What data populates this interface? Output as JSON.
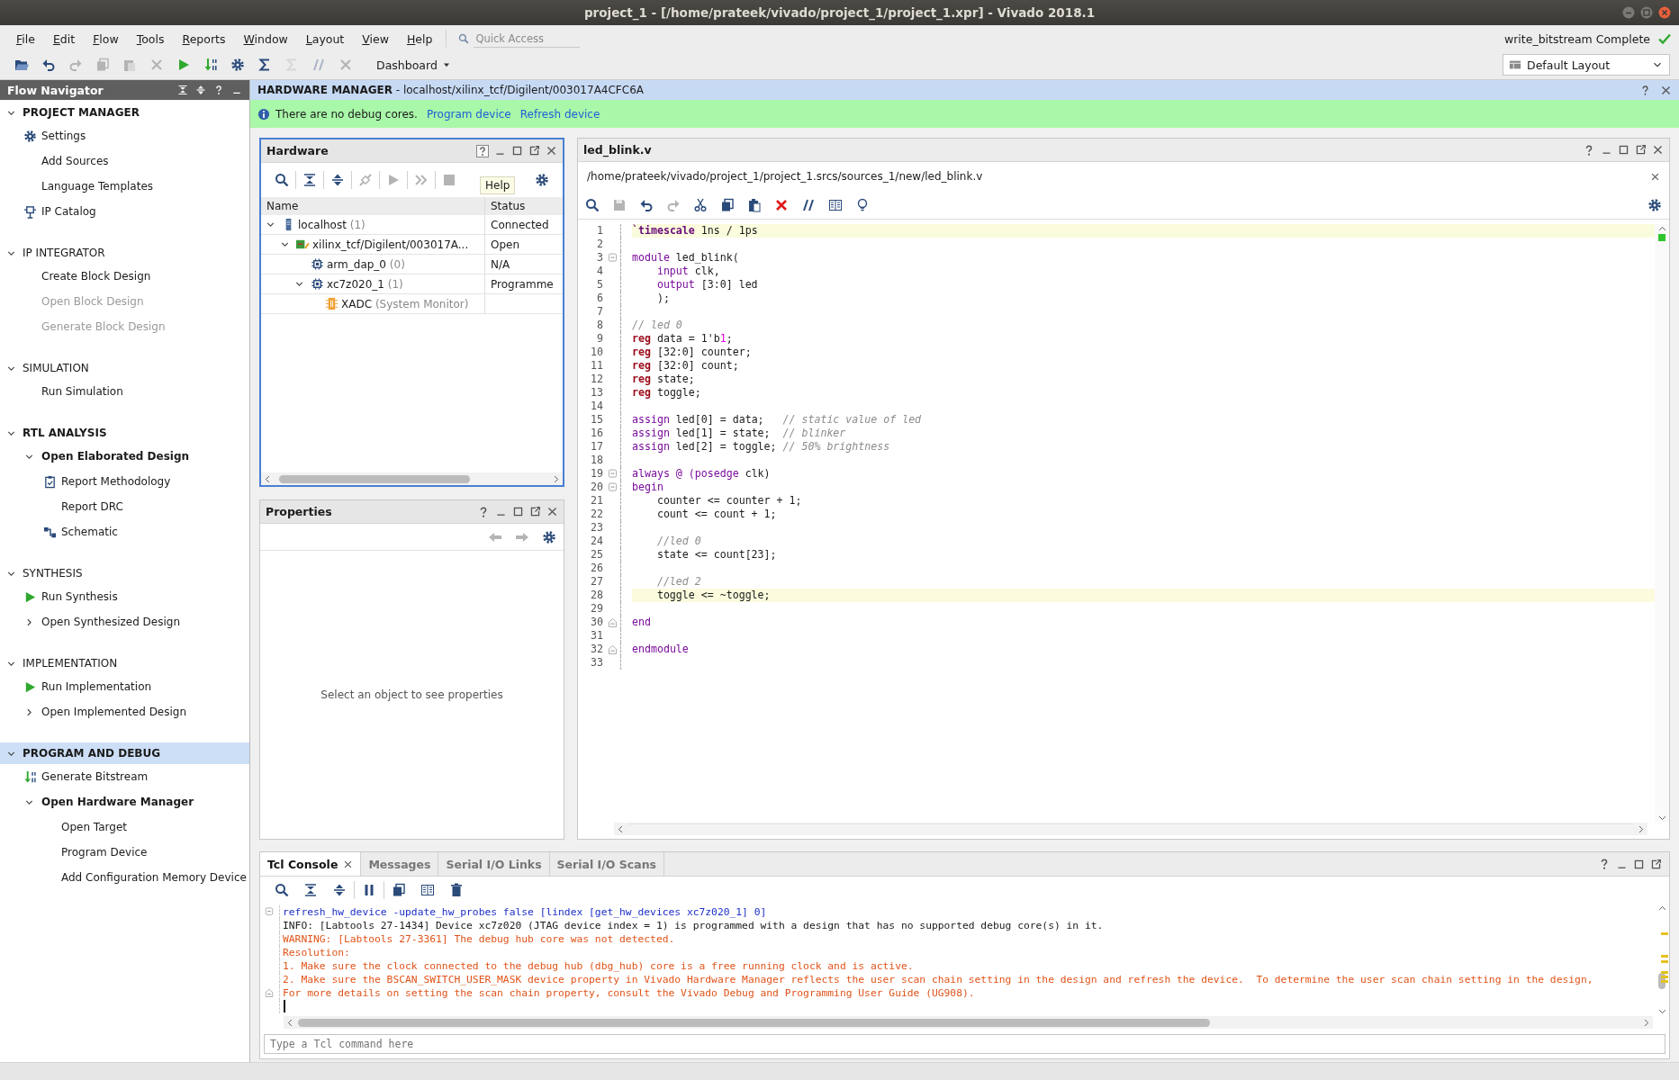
{
  "window": {
    "title": "project_1 - [/home/prateek/vivado/project_1/project_1.xpr] - Vivado 2018.1"
  },
  "menu": [
    "File",
    "Edit",
    "Flow",
    "Tools",
    "Reports",
    "Window",
    "Layout",
    "View",
    "Help"
  ],
  "quick_access": {
    "placeholder": "Quick Access"
  },
  "toolbar": {
    "dashboard": "Dashboard"
  },
  "run_status": {
    "text": "write_bitstream Complete",
    "done": true
  },
  "layout_selector": {
    "value": "Default Layout"
  },
  "flow_navigator": {
    "title": "Flow Navigator",
    "sections": [
      {
        "title": "PROJECT MANAGER",
        "active": true,
        "selected": false,
        "expanded": true,
        "items": [
          {
            "label": "Settings",
            "kind": "gear",
            "disabled": false,
            "active": false
          },
          {
            "label": "Add Sources",
            "kind": "plain",
            "disabled": false,
            "active": false
          },
          {
            "label": "Language Templates",
            "kind": "plain",
            "disabled": false,
            "active": false
          },
          {
            "label": "IP Catalog",
            "kind": "ip",
            "disabled": false,
            "active": false
          }
        ]
      },
      {
        "title": "IP INTEGRATOR",
        "active": false,
        "selected": false,
        "expanded": true,
        "items": [
          {
            "label": "Create Block Design",
            "kind": "plain",
            "disabled": false,
            "active": false
          },
          {
            "label": "Open Block Design",
            "kind": "plain",
            "disabled": true,
            "active": false
          },
          {
            "label": "Generate Block Design",
            "kind": "plain",
            "disabled": true,
            "active": false
          }
        ]
      },
      {
        "title": "SIMULATION",
        "active": false,
        "selected": false,
        "expanded": true,
        "items": [
          {
            "label": "Run Simulation",
            "kind": "plain",
            "disabled": false,
            "active": false
          }
        ]
      },
      {
        "title": "RTL ANALYSIS",
        "active": true,
        "selected": false,
        "expanded": true,
        "items": [
          {
            "label": "Open Elaborated Design",
            "kind": "plain",
            "disabled": false,
            "active": true,
            "expanded": true,
            "children": [
              {
                "label": "Report Methodology",
                "kind": "report",
                "disabled": false,
                "active": false
              },
              {
                "label": "Report DRC",
                "kind": "plain",
                "disabled": false,
                "active": false
              },
              {
                "label": "Schematic",
                "kind": "schematic",
                "disabled": false,
                "active": false
              }
            ]
          }
        ]
      },
      {
        "title": "SYNTHESIS",
        "active": false,
        "selected": false,
        "expanded": true,
        "items": [
          {
            "label": "Run Synthesis",
            "kind": "run",
            "disabled": false,
            "active": false
          },
          {
            "label": "Open Synthesized Design",
            "kind": "plain",
            "disabled": false,
            "active": false,
            "expanded": false
          }
        ]
      },
      {
        "title": "IMPLEMENTATION",
        "active": false,
        "selected": false,
        "expanded": true,
        "items": [
          {
            "label": "Run Implementation",
            "kind": "run",
            "disabled": false,
            "active": false
          },
          {
            "label": "Open Implemented Design",
            "kind": "plain",
            "disabled": false,
            "active": false,
            "expanded": false
          }
        ]
      },
      {
        "title": "PROGRAM AND DEBUG",
        "active": true,
        "selected": true,
        "expanded": true,
        "items": [
          {
            "label": "Generate Bitstream",
            "kind": "bitstream",
            "disabled": false,
            "active": false
          },
          {
            "label": "Open Hardware Manager",
            "kind": "plain",
            "disabled": false,
            "active": true,
            "expanded": true,
            "children": [
              {
                "label": "Open Target",
                "kind": "plain",
                "disabled": false,
                "active": false
              },
              {
                "label": "Program Device",
                "kind": "plain",
                "disabled": false,
                "active": false
              },
              {
                "label": "Add Configuration Memory Device",
                "kind": "plain",
                "disabled": false,
                "active": false
              }
            ]
          }
        ]
      }
    ]
  },
  "hardware_manager": {
    "title": "HARDWARE MANAGER",
    "target": " - localhost/xilinx_tcf/Digilent/003017A4CFC6A",
    "info": {
      "message": "There are no debug cores.",
      "links": [
        "Program device",
        "Refresh device"
      ]
    }
  },
  "hardware": {
    "title": "Hardware",
    "tooltip": "Help",
    "columns": [
      "Name",
      "Status"
    ],
    "rows": [
      {
        "name": "localhost",
        "count": "(1)",
        "status": "Connected",
        "kind": "server",
        "expanded": true,
        "children": [
          {
            "name": "xilinx_tcf/Digilent/003017A...",
            "status": "Open",
            "kind": "board",
            "expanded": true,
            "children": [
              {
                "name": "arm_dap_0",
                "count": "(0)",
                "status": "N/A",
                "kind": "chip"
              },
              {
                "name": "xc7z020_1",
                "count": "(1)",
                "status": "Programme",
                "kind": "chip",
                "expanded": true,
                "children": [
                  {
                    "name": "XADC",
                    "count": "(System Monitor)",
                    "kind": "monitor"
                  }
                ]
              }
            ]
          }
        ]
      }
    ]
  },
  "properties": {
    "title": "Properties",
    "empty_message": "Select an object to see properties"
  },
  "editor": {
    "title": "led_blink.v",
    "path": "/home/prateek/vivado/project_1/project_1.srcs/sources_1/new/led_blink.v",
    "lines": [
      {
        "number": "1",
        "highlighted": true,
        "indented": false,
        "tokens": [
          {
            "kind": "directive",
            "text": "`timescale"
          },
          {
            "kind": "text",
            "text": " 1ns / 1ps"
          }
        ]
      },
      {
        "number": "2",
        "highlighted": false
      },
      {
        "number": "3",
        "highlighted": false,
        "indented": false,
        "fold_start": true,
        "tokens": [
          {
            "kind": "keyword",
            "text": "module"
          },
          {
            "kind": "text",
            "text": " led_blink("
          }
        ]
      },
      {
        "number": "4",
        "highlighted": false,
        "indented": true,
        "tokens": [
          {
            "kind": "keyword",
            "text": "input"
          },
          {
            "kind": "text",
            "text": " clk,"
          }
        ]
      },
      {
        "number": "5",
        "highlighted": false,
        "indented": true,
        "tokens": [
          {
            "kind": "keyword",
            "text": "output"
          },
          {
            "kind": "text",
            "text": " [3:0] led"
          }
        ]
      },
      {
        "number": "6",
        "highlighted": false,
        "indented": true,
        "tokens": [
          {
            "kind": "text",
            "text": ");"
          }
        ]
      },
      {
        "number": "7",
        "highlighted": false
      },
      {
        "number": "8",
        "highlighted": false,
        "indented": false,
        "tokens": [
          {
            "kind": "comment",
            "text": "// led 0"
          }
        ]
      },
      {
        "number": "9",
        "highlighted": false,
        "indented": false,
        "tokens": [
          {
            "kind": "type",
            "text": "reg"
          },
          {
            "kind": "text",
            "text": " data = 1'b"
          },
          {
            "kind": "number",
            "text": "1"
          },
          {
            "kind": "text",
            "text": ";"
          }
        ]
      },
      {
        "number": "10",
        "highlighted": false,
        "indented": false,
        "tokens": [
          {
            "kind": "type",
            "text": "reg"
          },
          {
            "kind": "text",
            "text": " [32:0] counter;"
          }
        ]
      },
      {
        "number": "11",
        "highlighted": false,
        "indented": false,
        "tokens": [
          {
            "kind": "type",
            "text": "reg"
          },
          {
            "kind": "text",
            "text": " [32:0] count;"
          }
        ]
      },
      {
        "number": "12",
        "highlighted": false,
        "indented": false,
        "tokens": [
          {
            "kind": "type",
            "text": "reg"
          },
          {
            "kind": "text",
            "text": " state;"
          }
        ]
      },
      {
        "number": "13",
        "highlighted": false,
        "indented": false,
        "tokens": [
          {
            "kind": "type",
            "text": "reg"
          },
          {
            "kind": "text",
            "text": " toggle;"
          }
        ]
      },
      {
        "number": "14",
        "highlighted": false
      },
      {
        "number": "15",
        "highlighted": false,
        "indented": false,
        "tokens": [
          {
            "kind": "keyword",
            "text": "assign"
          },
          {
            "kind": "text",
            "text": " led[0] = data;   "
          },
          {
            "kind": "comment",
            "text": "// static value of led"
          }
        ]
      },
      {
        "number": "16",
        "highlighted": false,
        "indented": false,
        "tokens": [
          {
            "kind": "keyword",
            "text": "assign"
          },
          {
            "kind": "text",
            "text": " led[1] = state;  "
          },
          {
            "kind": "comment",
            "text": "// blinker"
          }
        ]
      },
      {
        "number": "17",
        "highlighted": false,
        "indented": false,
        "tokens": [
          {
            "kind": "keyword",
            "text": "assign"
          },
          {
            "kind": "text",
            "text": " led[2] = toggle; "
          },
          {
            "kind": "comment",
            "text": "// 50% brightness"
          }
        ]
      },
      {
        "number": "18",
        "highlighted": false
      },
      {
        "number": "19",
        "highlighted": false,
        "indented": false,
        "fold_start": true,
        "tokens": [
          {
            "kind": "keyword",
            "text": "always @ (posedge"
          },
          {
            "kind": "text",
            "text": " clk)"
          }
        ]
      },
      {
        "number": "20",
        "highlighted": false,
        "indented": false,
        "fold_start": true,
        "tokens": [
          {
            "kind": "keyword",
            "text": "begin"
          }
        ]
      },
      {
        "number": "21",
        "highlighted": false,
        "indented": true,
        "tokens": [
          {
            "kind": "text",
            "text": "counter <= counter + 1;"
          }
        ]
      },
      {
        "number": "22",
        "highlighted": false,
        "indented": true,
        "tokens": [
          {
            "kind": "text",
            "text": "count <= count + 1;"
          }
        ]
      },
      {
        "number": "23",
        "highlighted": false
      },
      {
        "number": "24",
        "highlighted": false,
        "indented": true,
        "tokens": [
          {
            "kind": "comment",
            "text": "//led 0"
          }
        ]
      },
      {
        "number": "25",
        "highlighted": false,
        "indented": true,
        "tokens": [
          {
            "kind": "text",
            "text": "state <= count[23];"
          }
        ]
      },
      {
        "number": "26",
        "highlighted": false
      },
      {
        "number": "27",
        "highlighted": false,
        "indented": true,
        "tokens": [
          {
            "kind": "comment",
            "text": "//led 2"
          }
        ]
      },
      {
        "number": "28",
        "highlighted": true,
        "indented": true,
        "tokens": [
          {
            "kind": "text",
            "text": "toggle <= ~toggle;"
          }
        ]
      },
      {
        "number": "29",
        "highlighted": false
      },
      {
        "number": "30",
        "highlighted": false,
        "indented": false,
        "fold_end": true,
        "tokens": [
          {
            "kind": "keyword",
            "text": "end"
          }
        ]
      },
      {
        "number": "31",
        "highlighted": false
      },
      {
        "number": "32",
        "highlighted": false,
        "indented": false,
        "fold_end": true,
        "tokens": [
          {
            "kind": "keyword",
            "text": "endmodule"
          }
        ]
      },
      {
        "number": "33",
        "highlighted": false
      }
    ]
  },
  "console": {
    "tabs": [
      {
        "label": "Tcl Console",
        "selected": true,
        "closable": true
      },
      {
        "label": "Messages",
        "selected": false,
        "closable": false
      },
      {
        "label": "Serial I/O Links",
        "selected": false,
        "closable": false
      },
      {
        "label": "Serial I/O Scans",
        "selected": false,
        "closable": false
      }
    ],
    "lines": [
      {
        "kind": "command",
        "fold_start": true,
        "text": "refresh_hw_device -update_hw_probes false [lindex [get_hw_devices xc7z020_1] 0]"
      },
      {
        "kind": "info",
        "text": "INFO: [Labtools 27-1434] Device xc7z020 (JTAG device index = 1) is programmed with a design that has no supported debug core(s) in it."
      },
      {
        "kind": "warning",
        "text": "WARNING: [Labtools 27-3361] The debug hub core was not detected."
      },
      {
        "kind": "warning",
        "text": "Resolution:"
      },
      {
        "kind": "warning",
        "text": "1. Make sure the clock connected to the debug hub (dbg_hub) core is a free running clock and is active."
      },
      {
        "kind": "warning",
        "text": "2. Make sure the BSCAN_SWITCH_USER_MASK device property in Vivado Hardware Manager reflects the user scan chain setting in the design and refresh the device.  To determine the user scan chain setting in the design,"
      },
      {
        "kind": "warning",
        "fold_end": true,
        "text": "For more details on setting the scan chain property, consult the Vivado Debug and Programming User Guide (UG908)."
      }
    ],
    "input": {
      "placeholder": "Type a Tcl command here"
    }
  }
}
